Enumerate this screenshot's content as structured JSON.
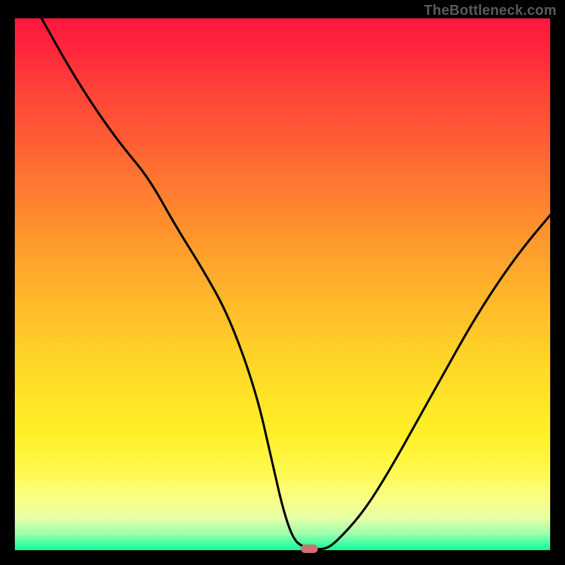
{
  "watermark": "TheBottleneck.com",
  "chart_data": {
    "type": "line",
    "title": "",
    "xlabel": "",
    "ylabel": "",
    "xlim": [
      0,
      100
    ],
    "ylim": [
      0,
      100
    ],
    "series": [
      {
        "name": "curve",
        "x": [
          5,
          10,
          15,
          20,
          25,
          30,
          35,
          40,
          45,
          48,
          50,
          52,
          54,
          56,
          58,
          60,
          65,
          70,
          75,
          80,
          85,
          90,
          95,
          100
        ],
        "y": [
          100,
          91,
          83,
          76,
          70,
          61,
          53,
          44,
          30,
          17,
          8,
          2,
          0.5,
          0.2,
          0.2,
          1.5,
          7,
          15,
          24,
          33,
          42,
          50,
          57,
          63
        ]
      }
    ],
    "marker": {
      "x": 55,
      "y": 0.2
    },
    "background_gradient": {
      "top": "#ff163e",
      "bottom": "#17f593"
    },
    "colors": {
      "curve": "#000000",
      "marker": "#d17070",
      "frame": "#000000"
    }
  }
}
